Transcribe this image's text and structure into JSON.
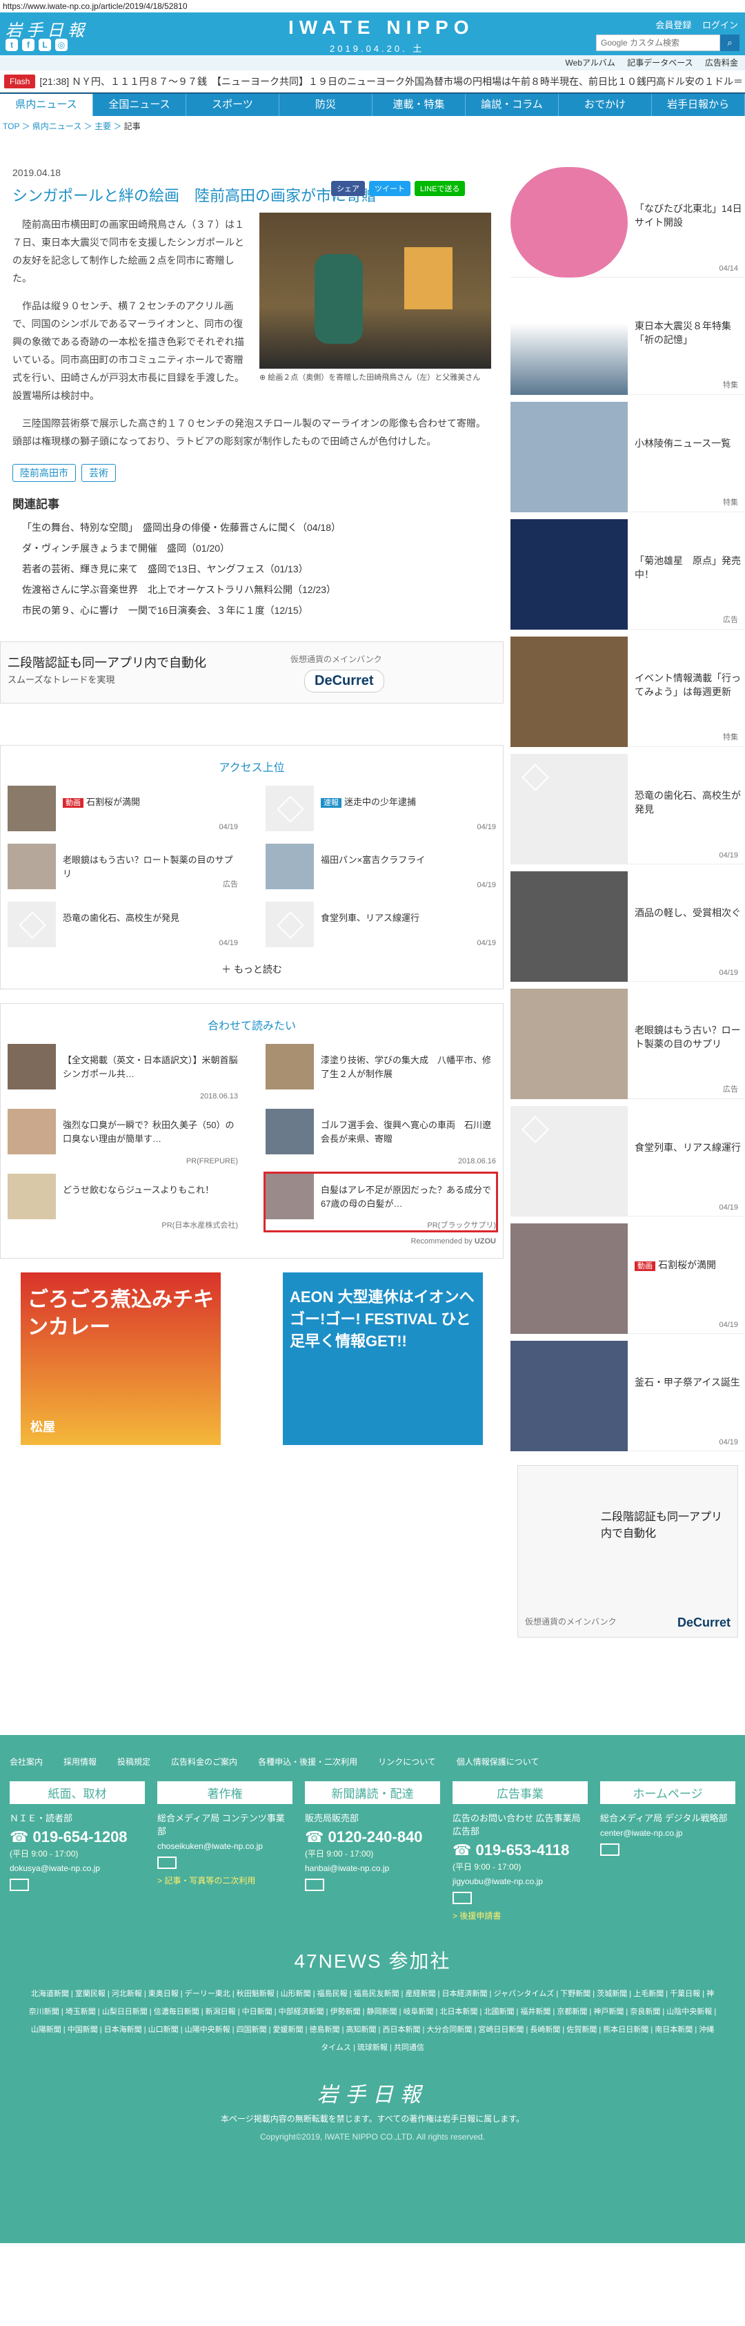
{
  "url": "https://www.iwate-np.co.jp/article/2019/4/18/52810",
  "header": {
    "logo": "岩手日報",
    "brand": "IWATE NIPPO",
    "date": "2019.04.20. 土",
    "links": [
      "会員登録",
      "ログイン"
    ],
    "search_placeholder": "Google カスタム検索",
    "sublinks": [
      "Webアルバム",
      "記事データベース",
      "広告料金"
    ]
  },
  "flash": {
    "label": "Flash",
    "text": "[21:38] ＮＹ円、１１１円８７～９７銭　【ニューヨーク共同】１９日のニューヨーク外国為替市場の円相場は午前８時半現在、前日比１０銭円高ドル安の１ドル＝１"
  },
  "nav": [
    "県内ニュース",
    "全国ニュース",
    "スポーツ",
    "防災",
    "連載・特集",
    "論説・コラム",
    "おでかけ",
    "岩手日報から"
  ],
  "breadcrumb": [
    "TOP",
    "県内ニュース",
    "主要",
    "記事"
  ],
  "article": {
    "date": "2019.04.18",
    "title": "シンガポールと絆の絵画　陸前高田の画家が市に寄贈",
    "share": [
      "シェア",
      "ツイート",
      "LINEで送る"
    ],
    "caption": "絵画２点（奥側）を寄贈した田崎飛鳥さん（左）と父雅美さん",
    "paragraphs": [
      "陸前高田市横田町の画家田崎飛鳥さん（３７）は１７日、東日本大震災で同市を支援したシンガポールとの友好を記念して制作した絵画２点を同市に寄贈した。",
      "作品は縦９０センチ、横７２センチのアクリル画で、同国のシンボルであるマーライオンと、同市の復興の象徴である奇跡の一本松を描き色彩でそれぞれ描いている。同市高田町の市コミュニティホールで寄贈式を行い、田崎さんが戸羽太市長に目録を手渡した。設置場所は検討中。",
      "三陸国際芸術祭で展示した高さ約１７０センチの発泡スチロール製のマーライオンの彫像も合わせて寄贈。頭部は権現様の獅子頭になっており、ラトビアの彫刻家が制作したもので田崎さんが色付けした。"
    ],
    "tags": [
      "陸前高田市",
      "芸術"
    ],
    "related_heading": "関連記事",
    "related": [
      "「生の舞台、特別な空間」　盛岡出身の俳優・佐藤晋さんに聞く（04/18）",
      "ダ・ヴィンチ展きょうまで開催　盛岡（01/20）",
      "若者の芸術、輝き見に来て　盛岡で13日、ヤングフェス（01/13）",
      "佐渡裕さんに学ぶ音楽世界　北上でオーケストラリハ無料公開（12/23）",
      "市民の第９、心に響け　一関で16日演奏会、３年に１度（12/15）"
    ]
  },
  "banner": {
    "line1": "二段階認証も同一アプリ内で自動化",
    "line2": "スムーズなトレードを実現",
    "line3": "仮想通貨のメインバンク",
    "brand": "DeCurret"
  },
  "access": {
    "heading": "アクセス上位",
    "items": [
      {
        "badge": "動画",
        "text": "石割桜が満開",
        "date": "04/19"
      },
      {
        "badge": "速報",
        "text": "迷走中の少年逮捕",
        "date": "04/19"
      },
      {
        "badge": "",
        "text": "老眼鏡はもう古い？ロート製薬の目のサプリ",
        "date": "広告"
      },
      {
        "badge": "",
        "text": "福田パン×富吉クラフライ",
        "date": "04/19"
      },
      {
        "badge": "",
        "text": "恐竜の歯化石、高校生が発見",
        "date": "04/19"
      },
      {
        "badge": "",
        "text": "食堂列車、リアス線運行",
        "date": "04/19"
      }
    ],
    "more": "もっと読む"
  },
  "recommend": {
    "heading": "合わせて読みたい",
    "items": [
      {
        "text": "【全文掲載（英文・日本語訳文）】米朝首脳シンガポール共…",
        "date": "2018.06.13"
      },
      {
        "text": "漆塗り技術、学びの集大成　八幡平市、修了生２人が制作展",
        "date": ""
      },
      {
        "text": "強烈な口臭が一瞬で？秋田久美子（50）の口臭ない理由が簡単す…",
        "date": "PR(FREPURE)"
      },
      {
        "text": "ゴルフ選手会、復興へ寛心の車両　石川遼会長が来県、寄贈",
        "date": "2018.06.16"
      },
      {
        "text": "どうせ飲むならジュースよりもこれ！",
        "date": "PR(日本水産株式会社)"
      },
      {
        "text": "白髪はアレ不足が原因だった？ある成分で67歳の母の白髪が…",
        "date": "PR(ブラックサプリ)"
      }
    ],
    "credit": "Recommended by"
  },
  "ads": [
    {
      "text": "ごろごろ煮込みチキンカレー",
      "brand": "松屋"
    },
    {
      "text": "AEON 大型連休はイオンへ ゴー!ゴー! FESTIVAL ひと足早く情報GET!!",
      "brand": "AEON"
    }
  ],
  "side": [
    {
      "text": "「なびたび北東北」14日サイト開設",
      "date": "04/14"
    },
    {
      "text": "東日本大震災８年特集「祈の記憶」",
      "date": "特集"
    },
    {
      "text": "小林陵侑ニュース一覧",
      "date": "特集"
    },
    {
      "text": "「菊池雄星　原点」発売中！",
      "date": "広告"
    },
    {
      "text": "イベント情報満載「行ってみよう」は毎週更新",
      "date": "特集"
    },
    {
      "text": "恐竜の歯化石、高校生が発見",
      "date": "04/19"
    },
    {
      "text": "酒品の軽し、受賞相次ぐ",
      "date": "04/19"
    },
    {
      "text": "老眼鏡はもう古い？ロート製薬の目のサプリ",
      "date": "広告"
    },
    {
      "text": "食堂列車、リアス線運行",
      "date": "04/19"
    },
    {
      "text": "石割桜が満開",
      "badge": "動画",
      "date": "04/19"
    },
    {
      "text": "釜石・甲子祭アイス誕生",
      "date": "04/19"
    }
  ],
  "footer": {
    "links": [
      "会社案内",
      "採用情報",
      "投稿規定",
      "広告料金のご案内",
      "各種申込・後援・二次利用",
      "リンクについて",
      "個人情報保護について"
    ],
    "cols": [
      {
        "head": "紙面、取材",
        "sub": "ＮＩＥ・読者部",
        "phone": "019-654-1208",
        "hours": "(平日 9:00 - 17:00)",
        "mail": "dokusya@iwate-np.co.jp",
        "note": ""
      },
      {
        "head": "著作権",
        "sub": "総合メディア局 コンテンツ事業部",
        "phone": "",
        "hours": "",
        "mail": "choseikuken@iwate-np.co.jp",
        "note": "> 記事・写真等の二次利用"
      },
      {
        "head": "新聞講読・配達",
        "sub": "販売局販売部",
        "phone": "0120-240-840",
        "hours": "(平日 9:00 - 17:00)",
        "mail": "hanbai@iwate-np.co.jp",
        "note": ""
      },
      {
        "head": "広告事業",
        "sub": "広告のお問い合わせ 広告事業局広告部",
        "phone": "019-653-4118",
        "hours": "(平日 9:00 - 17:00)",
        "mail": "jigyoubu@iwate-np.co.jp",
        "note": "> 後援申請書"
      },
      {
        "head": "ホームページ",
        "sub": "総合メディア局 デジタル戦略部",
        "phone": "",
        "hours": "",
        "mail": "center@iwate-np.co.jp",
        "note": ""
      }
    ],
    "n47": "47NEWS 参加社",
    "papers": "北海道新聞 | 室蘭民報 | 河北新報 | 東奥日報 | デーリー東北 | 秋田魁新報 | 山形新聞 | 福島民報 | 福島民友新聞 | 産経新聞 | 日本経済新聞 | ジャパンタイムズ | 下野新聞 | 茨城新聞 | 上毛新聞 | 千葉日報 | 神奈川新聞 | 埼玉新聞 | 山梨日日新聞 | 信濃毎日新聞 | 新潟日報 | 中日新聞 | 中部経済新聞 | 伊勢新聞 | 静岡新聞 | 岐阜新聞 | 北日本新聞 | 北國新聞 | 福井新聞 | 京都新聞 | 神戸新聞 | 奈良新聞 | 山陰中央新報 | 山陽新聞 | 中国新聞 | 日本海新聞 | 山口新聞 | 山陽中央新報 | 四国新聞 | 愛媛新聞 | 徳島新聞 | 高知新聞 | 西日本新聞 | 大分合同新聞 | 宮崎日日新聞 | 長崎新聞 | 佐賀新聞 | 熊本日日新聞 | 南日本新聞 | 沖縄タイムス | 琉球新報 | 共同通信",
    "logo": "岩手日報",
    "notice": "本ページ掲載内容の無断転載を禁じます。すべての著作権は岩手日報に属します。",
    "copyright": "Copyright©2019, IWATE NIPPO CO.,LTD. All rights reserved."
  }
}
